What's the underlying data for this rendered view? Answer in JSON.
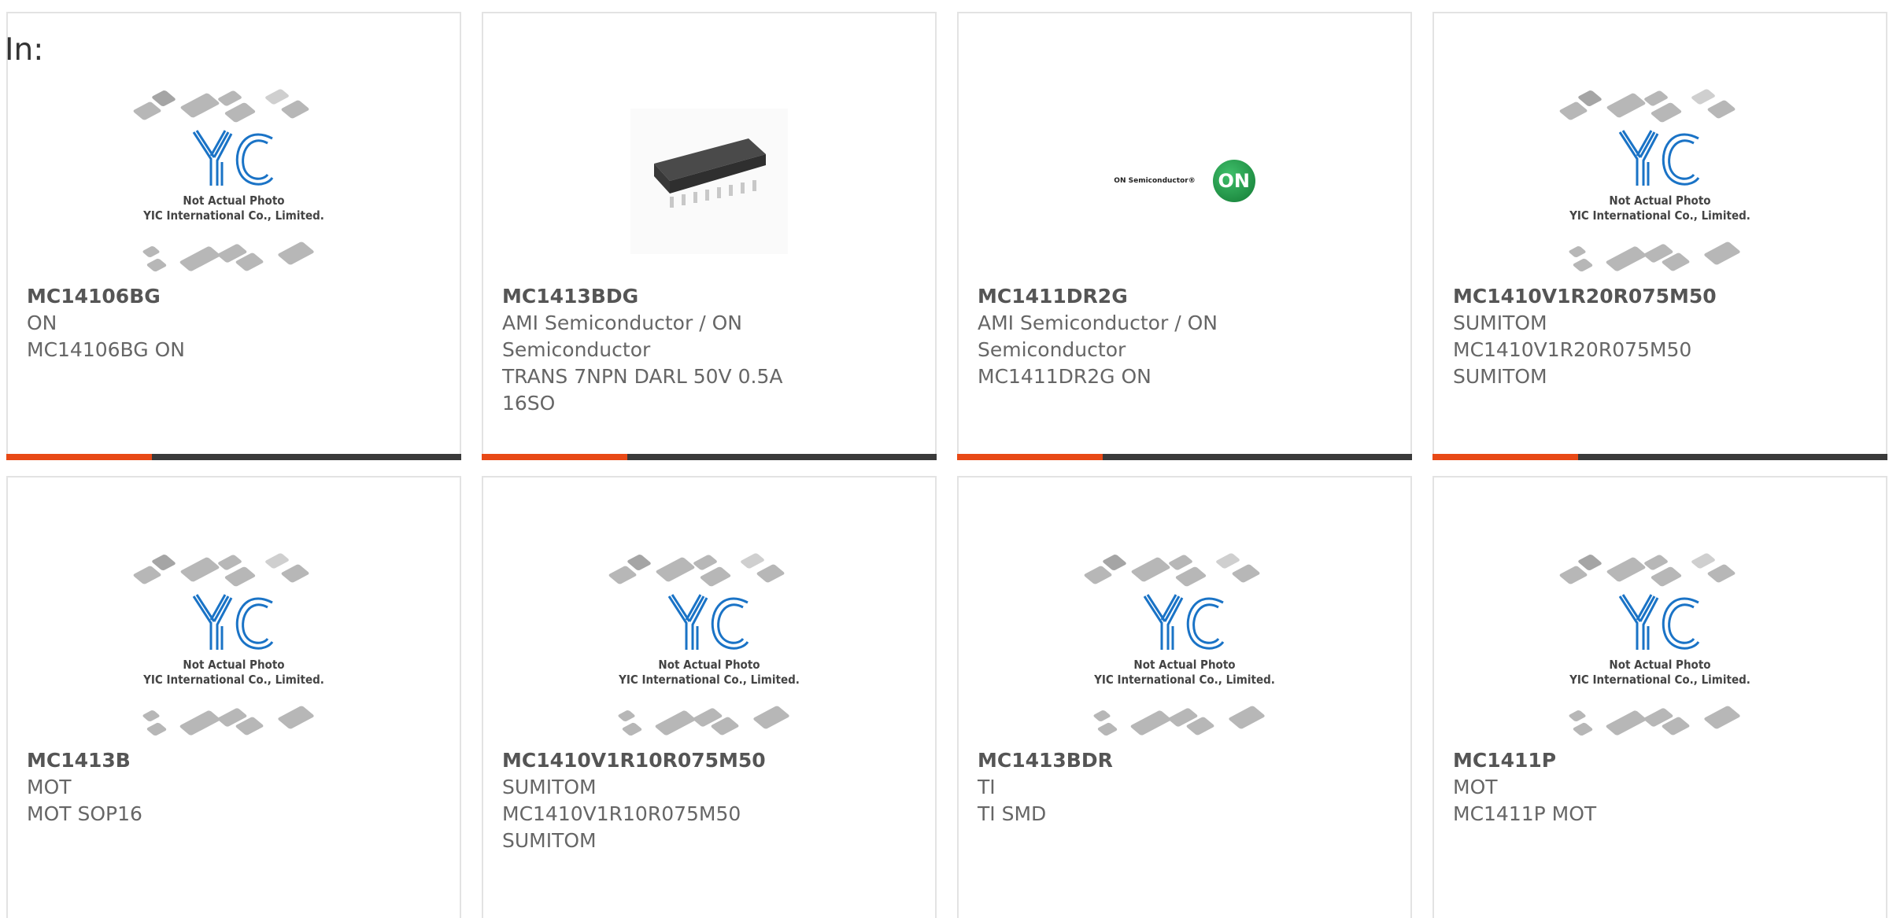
{
  "filter_label": "In:",
  "placeholder_text": [
    "Not Actual Photo",
    "YIC International Co., Limited."
  ],
  "on_logo": {
    "wordmark": "ON Semiconductor®",
    "mark": "ON"
  },
  "colors": {
    "accent": "#e84916",
    "bar_track": "#3a3a3a",
    "logo_blue": "#1a73c6"
  },
  "cards": [
    {
      "part": "MC14106BG",
      "manufacturer": "ON",
      "description": "MC14106BG ON",
      "image": "placeholder",
      "progress": 0.32
    },
    {
      "part": "MC1413BDG",
      "manufacturer": "AMI Semiconductor / ON Semiconductor",
      "description": "TRANS 7NPN DARL 50V 0.5A 16SO",
      "image": "chip-photo",
      "progress": 0.32
    },
    {
      "part": "MC1411DR2G",
      "manufacturer": "AMI Semiconductor / ON Semiconductor",
      "description": "MC1411DR2G ON",
      "image": "on-logo",
      "progress": 0.32
    },
    {
      "part": "MC1410V1R20R075M50",
      "manufacturer": "SUMITOM",
      "description": "MC1410V1R20R075M50 SUMITOM",
      "image": "placeholder",
      "progress": 0.32
    },
    {
      "part": "MC1413B",
      "manufacturer": "MOT",
      "description": "MOT SOP16",
      "image": "placeholder"
    },
    {
      "part": "MC1410V1R10R075M50",
      "manufacturer": "SUMITOM",
      "description": "MC1410V1R10R075M50 SUMITOM",
      "image": "placeholder"
    },
    {
      "part": "MC1413BDR",
      "manufacturer": "TI",
      "description": "TI SMD",
      "image": "placeholder"
    },
    {
      "part": "MC1411P",
      "manufacturer": "MOT",
      "description": "MC1411P MOT",
      "image": "placeholder"
    }
  ]
}
